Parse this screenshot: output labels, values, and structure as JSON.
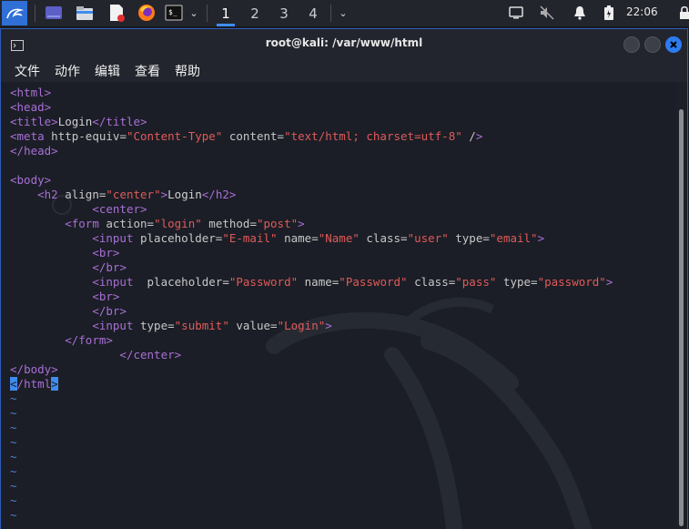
{
  "taskbar": {
    "workspaces": [
      "1",
      "2",
      "3",
      "4"
    ],
    "active_workspace": "1",
    "clock": "22:06",
    "icons": [
      "kali-menu-icon",
      "desktop-icon",
      "file-manager-icon",
      "text-editor-icon",
      "firefox-icon",
      "terminal-icon",
      "chevron-down-icon",
      "chevron-down-icon",
      "screen-icon",
      "mute-icon",
      "bell-icon",
      "battery-icon",
      "lock-icon"
    ]
  },
  "window": {
    "title": "root@kali: /var/www/html",
    "menu": [
      "文件",
      "动作",
      "编辑",
      "查看",
      "帮助"
    ]
  },
  "editor": {
    "lines": [
      "<html>",
      "<head>",
      "<title>Login</title>",
      "<meta http-equiv=\"Content-Type\" content=\"text/html; charset=utf-8\" />",
      "</head>",
      "",
      "<body>",
      "    <h2 align=\"center\">Login</h2>",
      "            <center>",
      "        <form action=\"login\" method=\"post\">",
      "            <input placeholder=\"E-mail\" name=\"Name\" class=\"user\" type=\"email\">",
      "            <br>",
      "            </br>",
      "            <input  placeholder=\"Password\" name=\"Password\" class=\"pass\" type=\"password\">",
      "            <br>",
      "            </br>",
      "            <input type=\"submit\" value=\"Login\">",
      "        </form>",
      "                </center>",
      "</body>",
      "</html>",
      "~",
      "~",
      "~",
      "~",
      "~",
      "~",
      "~",
      "~",
      "~"
    ]
  },
  "colors": {
    "accent": "#3f8cf0",
    "tag": "#a86fd6",
    "string": "#e05a5a",
    "tilde": "#4a7fd9"
  }
}
